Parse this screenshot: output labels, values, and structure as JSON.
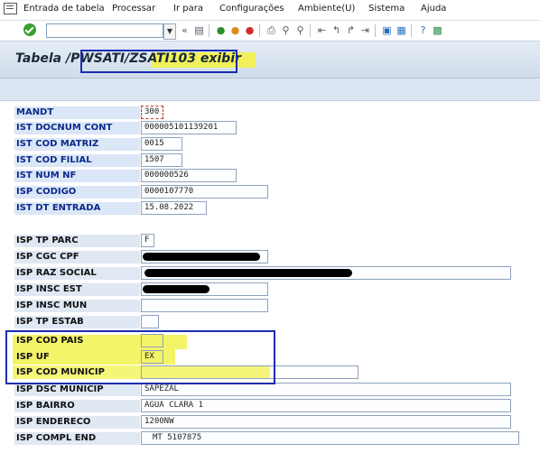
{
  "menu": {
    "items": [
      "Entrada de tabela",
      "Processar",
      "Ir para",
      "Configurações",
      "Ambiente(U)",
      "Sistema",
      "Ajuda"
    ]
  },
  "toolbar": {
    "command_value": "",
    "icons": [
      "back-arrows-icon",
      "save-icon",
      "back-icon",
      "exit-icon",
      "cancel-icon",
      "print-icon",
      "find-icon",
      "find-next-icon",
      "first-page-icon",
      "prev-page-icon",
      "next-page-icon",
      "last-page-icon",
      "new-session-icon",
      "shortcut-icon",
      "help-icon",
      "customize-icon"
    ]
  },
  "title": {
    "prefix": "Tabela ",
    "path_a": "/PWSATI",
    "path_b": "/ZSATI103",
    "suffix": " exibir"
  },
  "fields": [
    {
      "label": "MANDT",
      "value": "300",
      "key": true
    },
    {
      "label": "IST DOCNUM CONT",
      "value": "000005101139201",
      "key": true
    },
    {
      "label": "IST COD MATRIZ",
      "value": "0015",
      "key": true
    },
    {
      "label": "IST COD FILIAL",
      "value": "1507",
      "key": true
    },
    {
      "label": "IST NUM NF",
      "value": "000000526",
      "key": true
    },
    {
      "label": "ISP CODIGO",
      "value": "0000107770",
      "key": true
    },
    {
      "label": "IST DT ENTRADA",
      "value": "15.08.2022",
      "key": true
    },
    {
      "label": "ISP TP PARC",
      "value": "F",
      "key": false
    },
    {
      "label": "ISP CGC CPF",
      "value": "",
      "key": false
    },
    {
      "label": "ISP RAZ SOCIAL",
      "value": "",
      "key": false
    },
    {
      "label": "ISP INSC EST",
      "value": "",
      "key": false
    },
    {
      "label": "ISP INSC MUN",
      "value": "",
      "key": false
    },
    {
      "label": "ISP TP ESTAB",
      "value": "",
      "key": false
    },
    {
      "label": "ISP COD PAIS",
      "value": "",
      "key": false
    },
    {
      "label": "ISP UF",
      "value": "EX",
      "key": false
    },
    {
      "label": "ISP COD MUNICIP",
      "value": "",
      "key": false
    },
    {
      "label": "ISP DSC MUNICIP",
      "value": "SAPEZAL",
      "key": false
    },
    {
      "label": "ISP BAIRRO",
      "value": "AGUA CLARA 1",
      "key": false
    },
    {
      "label": "ISP ENDERECO",
      "value": "1200NW",
      "key": false
    },
    {
      "label": "ISP COMPL END",
      "value": "MT 5107875",
      "key": false
    }
  ],
  "colors": {
    "key_label": "#0c2a8c",
    "highlight_yellow": "#f2f24e",
    "highlight_border": "#1b2db0"
  }
}
